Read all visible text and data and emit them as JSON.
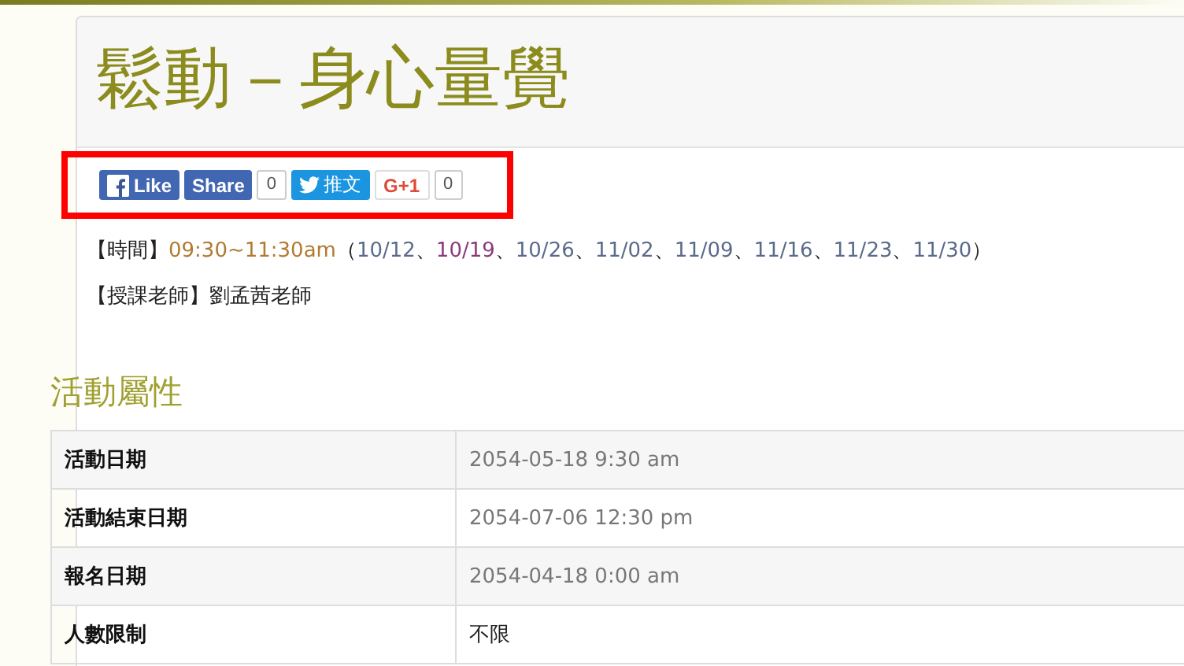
{
  "page_title": "鬆動－身心量覺",
  "share_bar": {
    "highlighted": true,
    "buttons": [
      {
        "kind": "like",
        "label": "Like"
      },
      {
        "kind": "share",
        "label": "Share",
        "count": "0"
      },
      {
        "kind": "tweet",
        "label": "推文"
      },
      {
        "kind": "gplus",
        "label": "G+1",
        "count": "0"
      }
    ]
  },
  "time_line": {
    "label": "【時間】",
    "time": "09:30~11:30am",
    "open": "（",
    "dates": [
      {
        "text": "10/12",
        "color": "#5a6a8a"
      },
      {
        "text": "10/19",
        "color": "#8a3a7a"
      },
      {
        "text": "10/26",
        "color": "#5a6a8a"
      },
      {
        "text": "11/02",
        "color": "#5a6a8a"
      },
      {
        "text": "11/09",
        "color": "#5a6a8a"
      },
      {
        "text": "11/16",
        "color": "#5a6a8a"
      },
      {
        "text": "11/23",
        "color": "#5a6a8a"
      },
      {
        "text": "11/30",
        "color": "#5a6a8a"
      }
    ],
    "separator": "、",
    "close": "）"
  },
  "teacher_line": "【授課老師】劉孟茜老師",
  "section_title": "活動屬性",
  "table": {
    "rows": [
      {
        "label": "活動日期",
        "value": "2054-05-18 9:30 am",
        "kind": "date"
      },
      {
        "label": "活動結束日期",
        "value": "2054-07-06 12:30 pm",
        "kind": "date"
      },
      {
        "label": "報名日期",
        "value": "2054-04-18 0:00 am",
        "kind": "date"
      },
      {
        "label": "人數限制",
        "value": "不限",
        "kind": "text"
      }
    ]
  }
}
